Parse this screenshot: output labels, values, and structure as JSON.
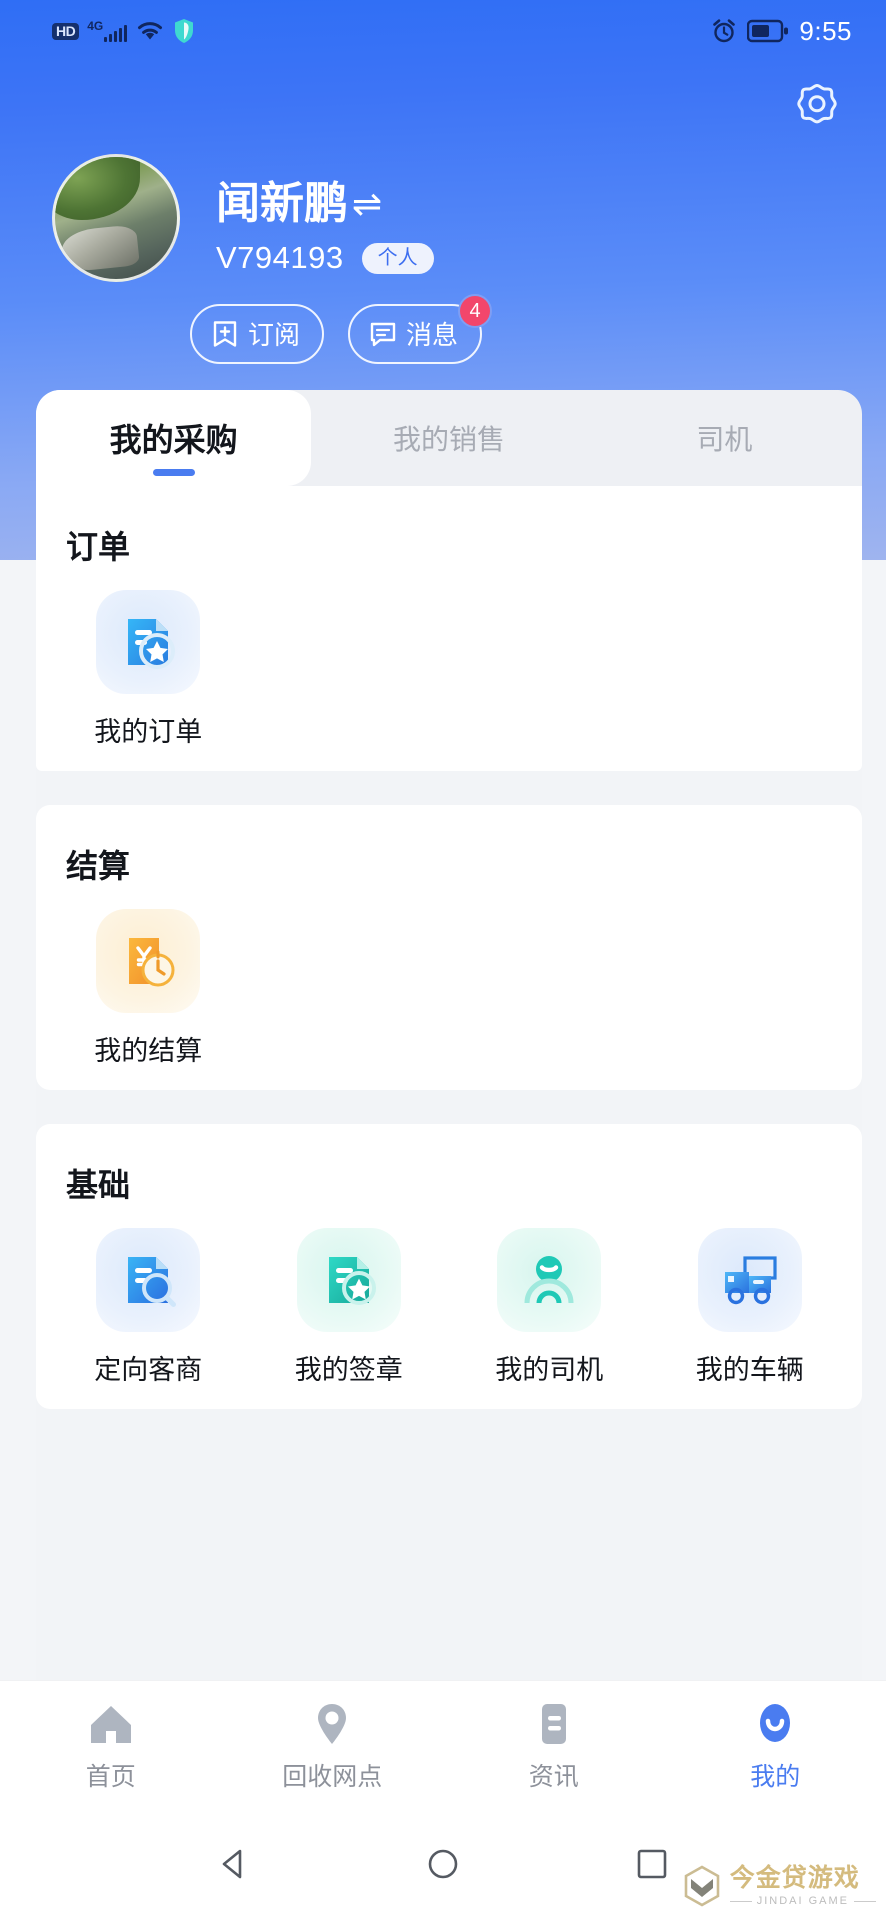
{
  "status_bar": {
    "hd_label": "HD",
    "network_label": "4G",
    "icons": [
      "hd-icon",
      "signal-bars-icon",
      "wifi-icon",
      "shield-icon",
      "alarm-icon",
      "battery-icon"
    ],
    "time": "9:55"
  },
  "header": {
    "settings_icon": "gear-icon",
    "background_color": "#4a7cf0"
  },
  "profile": {
    "avatar_alt": "user-avatar",
    "name": "闻新鹏",
    "swap_symbol": "⇌",
    "user_id": "V794193",
    "account_type_tag": "个人",
    "actions": [
      {
        "label": "订阅",
        "icon": "bookmark-plus-icon",
        "badge": null
      },
      {
        "label": "消息",
        "icon": "chat-bubble-icon",
        "badge": "4"
      }
    ]
  },
  "tabs": [
    {
      "label": "我的采购",
      "active": true
    },
    {
      "label": "我的销售",
      "active": false
    },
    {
      "label": "司机",
      "active": false
    }
  ],
  "sections": [
    {
      "title": "订单",
      "items": [
        {
          "label": "我的订单",
          "icon": "document-star-icon",
          "theme": "blue"
        }
      ]
    },
    {
      "title": "结算",
      "items": [
        {
          "label": "我的结算",
          "icon": "yuan-document-clock-icon",
          "theme": "amber"
        }
      ]
    },
    {
      "title": "基础",
      "items": [
        {
          "label": "定向客商",
          "icon": "document-search-icon",
          "theme": "blue"
        },
        {
          "label": "我的签章",
          "icon": "document-seal-star-icon",
          "theme": "teal"
        },
        {
          "label": "我的司机",
          "icon": "driver-person-icon",
          "theme": "teal"
        },
        {
          "label": "我的车辆",
          "icon": "truck-icon",
          "theme": "blue"
        }
      ]
    }
  ],
  "bottom_nav": [
    {
      "label": "首页",
      "icon": "home-icon",
      "active": false
    },
    {
      "label": "回收网点",
      "icon": "location-pin-icon",
      "active": false
    },
    {
      "label": "资讯",
      "icon": "news-list-icon",
      "active": false
    },
    {
      "label": "我的",
      "icon": "profile-smile-icon",
      "active": true
    }
  ],
  "system_nav": {
    "back_icon": "triangle-back-icon",
    "home_icon": "circle-home-icon",
    "recents_icon": "square-recents-icon"
  },
  "watermark": {
    "cn": "今金贷游戏",
    "en": "JINDAI GAME",
    "logo_icon": "hexagon-chevron-logo",
    "color": "#d2b878"
  },
  "colors": {
    "accent": "#4a7cf0",
    "badge": "#f2466b",
    "header_gradient_start": "#2f6ef5",
    "header_gradient_end": "#9fb4ef"
  }
}
